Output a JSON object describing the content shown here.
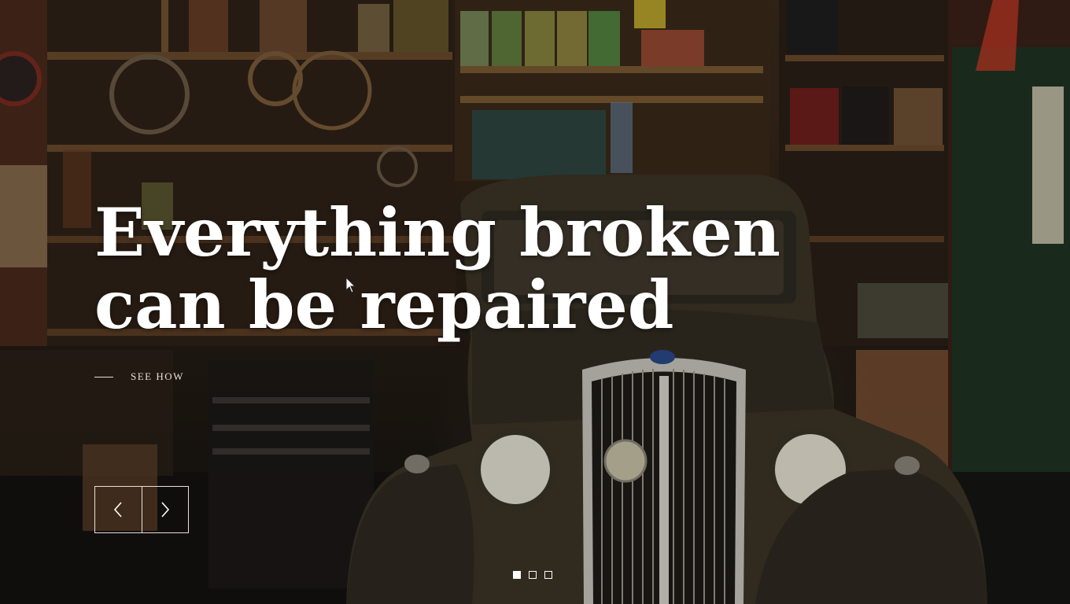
{
  "hero": {
    "headline": "Everything broken can be repaired",
    "cta_label": "SEE HOW",
    "text_color": "#ffffff"
  },
  "background": {
    "subject": "vintage car in a garage full of tools and shelves"
  },
  "slider": {
    "prev_icon": "chevron-left-icon",
    "next_icon": "chevron-right-icon",
    "slide_count": 3,
    "active_slide": 1
  }
}
